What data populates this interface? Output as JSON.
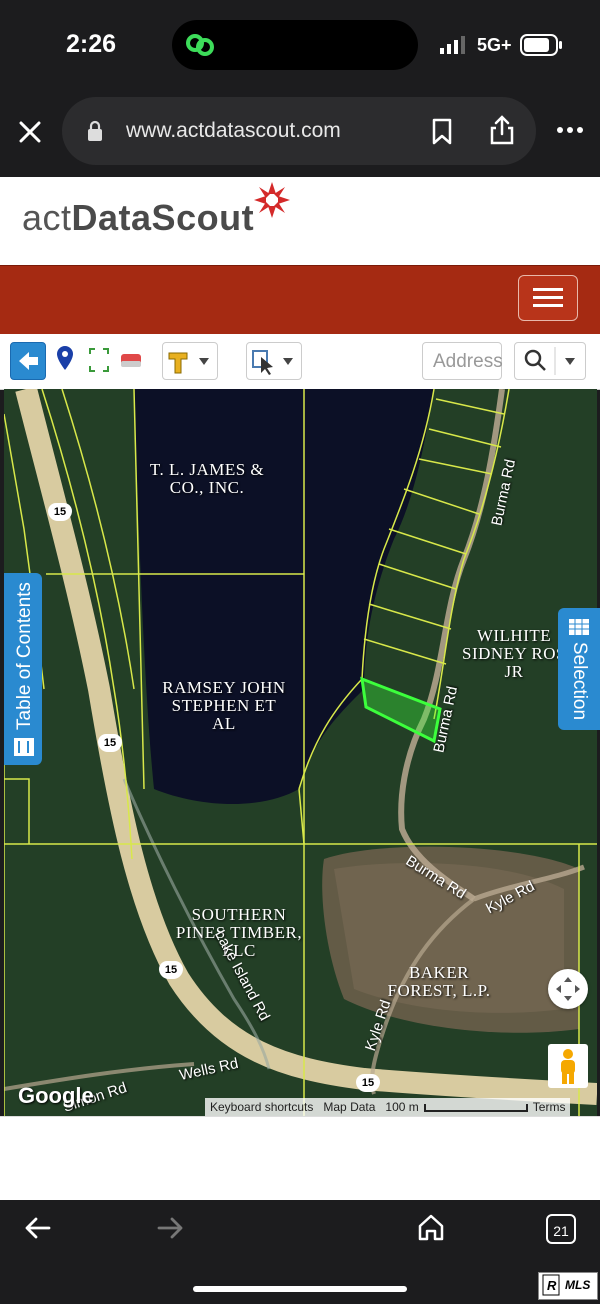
{
  "status": {
    "time": "2:26",
    "network": "5G+"
  },
  "browser": {
    "url": "www.actdatascout.com",
    "tab_count": "21"
  },
  "site": {
    "logo_prefix": "act",
    "logo_main": "DataScout"
  },
  "toolbar": {
    "address_placeholder": "Address"
  },
  "map": {
    "owners": [
      {
        "l1": "T. L. JAMES &",
        "l2": "CO., INC.",
        "l3": ""
      },
      {
        "l1": "RAMSEY JOHN",
        "l2": "STEPHEN ET",
        "l3": "AL"
      },
      {
        "l1": "WILHITE",
        "l2": "SIDNEY ROS",
        "l3": "JR"
      },
      {
        "l1": "SOUTHERN",
        "l2": "PINES TIMBER,",
        "l3": "LLC"
      },
      {
        "l1": "BAKER",
        "l2": "FOREST, L.P.",
        "l3": ""
      }
    ],
    "roads": {
      "burma1": "Burma Rd",
      "burma2": "Burma Rd",
      "burma3": "Burma Rd",
      "kyle1": "Kyle Rd",
      "kyle2": "Kyle Rd",
      "wells": "Wells Rd",
      "simon": "Simon Rd",
      "lake_island": "Lake Island Rd"
    },
    "route": "15",
    "google": "Google",
    "keyboard": "Keyboard shortcuts",
    "mapdata": "Map Data",
    "scale": "100 m",
    "terms": "Terms"
  },
  "side": {
    "toc": "Table of Contents",
    "selection": "Selection"
  },
  "mls_badge": "MLS",
  "colors": {
    "header_red": "#a52a12",
    "panel_blue": "#2a8ad0",
    "parcel_yellow": "#d8e84a",
    "selected_green": "#3cff3c"
  }
}
